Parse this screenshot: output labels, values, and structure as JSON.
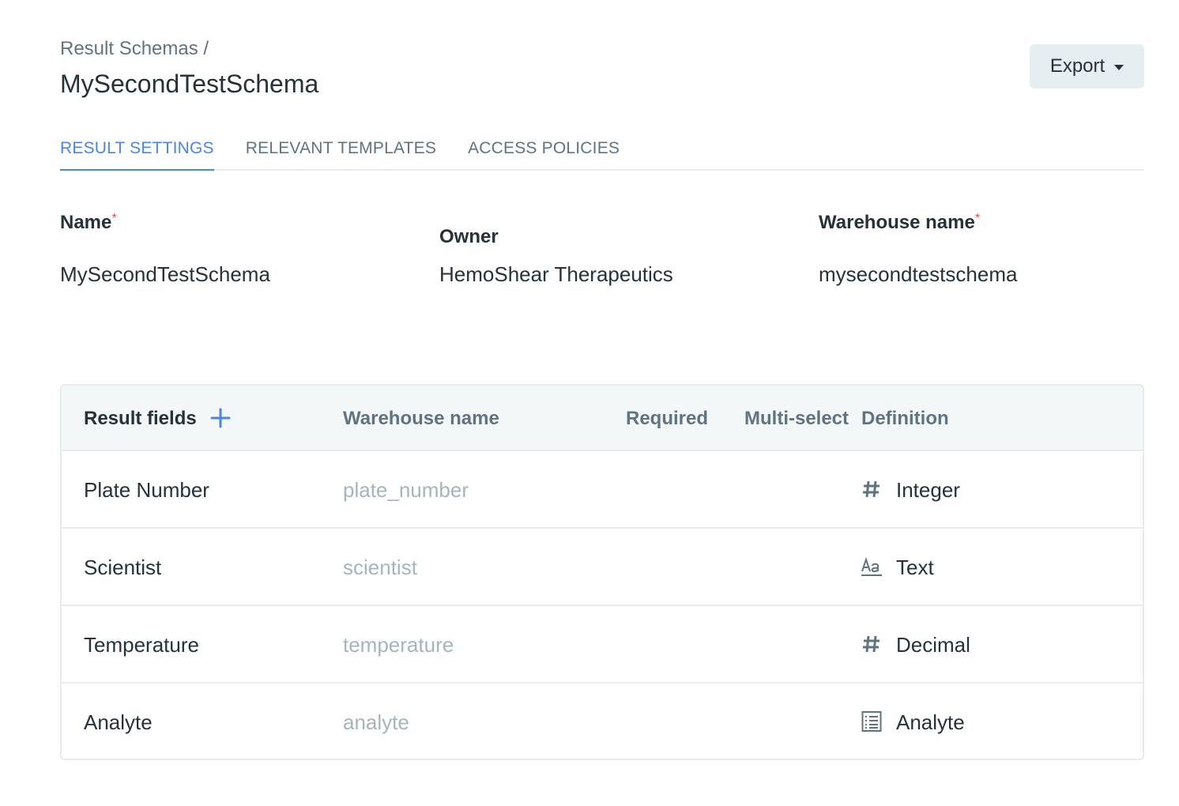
{
  "breadcrumb": {
    "parent": "Result Schemas /"
  },
  "title": "MySecondTestSchema",
  "export": {
    "label": "Export"
  },
  "tabs": [
    {
      "label": "RESULT SETTINGS",
      "active": true
    },
    {
      "label": "RELEVANT TEMPLATES",
      "active": false
    },
    {
      "label": "ACCESS POLICIES",
      "active": false
    }
  ],
  "settings": {
    "name": {
      "label": "Name",
      "required_mark": "*",
      "value": "MySecondTestSchema"
    },
    "owner": {
      "label": "Owner",
      "value": "HemoShear Therapeutics"
    },
    "warehouse": {
      "label": "Warehouse name",
      "required_mark": "*",
      "value": "mysecondtestschema"
    }
  },
  "table": {
    "columns": {
      "fields": "Result fields",
      "warehouse": "Warehouse name",
      "required": "Required",
      "multiselect": "Multi-select",
      "definition": "Definition"
    },
    "rows": [
      {
        "name": "Plate Number",
        "warehouse": "plate_number",
        "definition": "Integer",
        "icon": "hash-icon"
      },
      {
        "name": "Scientist",
        "warehouse": "scientist",
        "definition": "Text",
        "icon": "text-icon"
      },
      {
        "name": "Temperature",
        "warehouse": "temperature",
        "definition": "Decimal",
        "icon": "hash-icon"
      },
      {
        "name": "Analyte",
        "warehouse": "analyte",
        "definition": "Analyte",
        "icon": "list-icon"
      }
    ]
  },
  "colors": {
    "accent": "#4a87dd",
    "required": "#e05252",
    "muted": "#a7b4ba"
  }
}
